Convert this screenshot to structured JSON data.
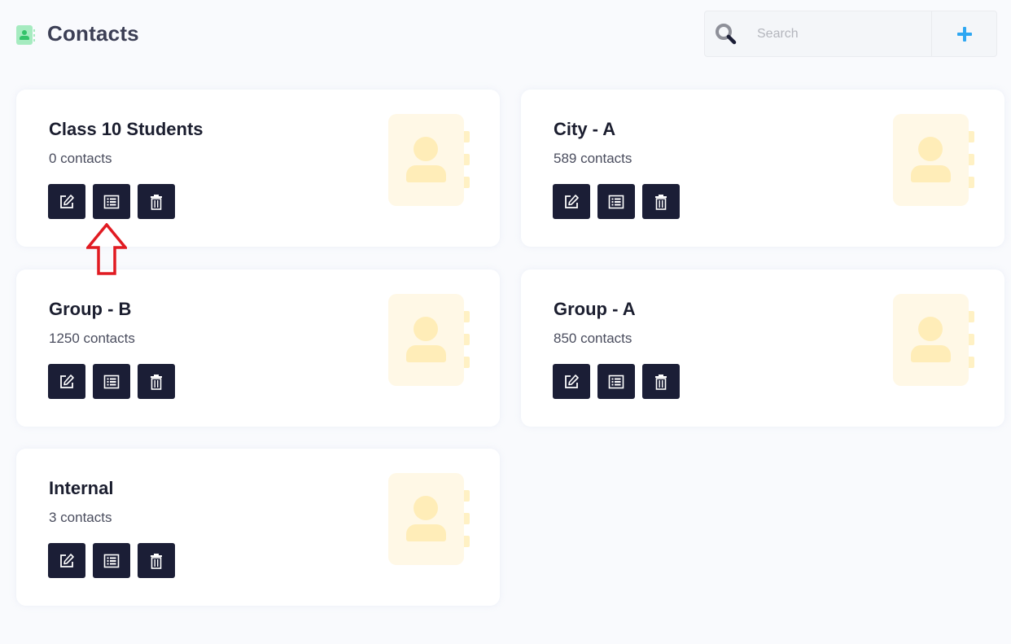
{
  "header": {
    "title": "Contacts",
    "title_icon": "address-book-icon"
  },
  "search": {
    "placeholder": "Search",
    "value": "",
    "icon": "search-icon"
  },
  "add_button": {
    "icon": "plus-icon",
    "color": "#2ea7f2"
  },
  "cards": [
    {
      "name": "Class 10 Students",
      "count": "0 contacts"
    },
    {
      "name": "City - A",
      "count": "589 contacts"
    },
    {
      "name": "Group - B",
      "count": "1250 contacts"
    },
    {
      "name": "Group - A",
      "count": "850 contacts"
    },
    {
      "name": "Internal",
      "count": "3 contacts"
    }
  ],
  "card_actions": [
    {
      "name": "edit",
      "icon": "edit-icon"
    },
    {
      "name": "view-list",
      "icon": "list-icon"
    },
    {
      "name": "delete",
      "icon": "trash-icon"
    }
  ],
  "annotation": {
    "type": "red-up-arrow",
    "color": "#e11b22",
    "points_to": "Class 10 Students view-list button"
  },
  "colors": {
    "background": "#f9fafd",
    "card": "#ffffff",
    "action_button": "#1b1e36",
    "title_icon": "#34c36a",
    "book_icon": "#fff8e6"
  }
}
